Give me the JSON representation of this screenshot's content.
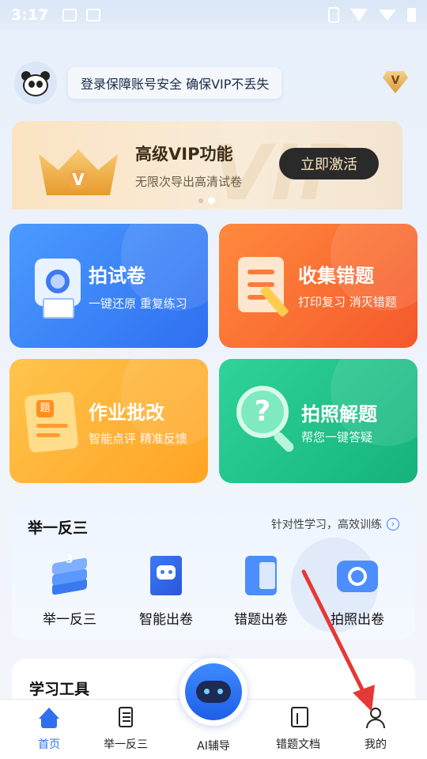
{
  "status": {
    "time": "3:17"
  },
  "header": {
    "banner": "登录保障账号安全 确保VIP不丢失",
    "vip_badge": "V"
  },
  "vip_card": {
    "title": "高级VIP功能",
    "subtitle": "无限次导出高清试卷",
    "button": "立即激活",
    "bg_text": "VIP",
    "crown_mark": "V",
    "pager": {
      "count": 2,
      "active": 2
    }
  },
  "tiles": [
    {
      "title": "拍试卷",
      "subtitle": "一键还原 重复练习",
      "icon": "camera-scan-icon"
    },
    {
      "title": "收集错题",
      "subtitle": "打印复习 消灭错题",
      "icon": "checklist-icon"
    },
    {
      "title": "作业批改",
      "subtitle": "智能点评 精准反馈",
      "icon": "homework-icon",
      "icon_text": "题"
    },
    {
      "title": "拍照解题",
      "subtitle": "帮您一键答疑",
      "icon": "question-search-icon",
      "icon_text": "?"
    }
  ],
  "practice": {
    "title": "举一反三",
    "link": "针对性学习，高效训练",
    "items": [
      {
        "label": "举一反三",
        "icon": "stack-icon",
        "icon_text": "3"
      },
      {
        "label": "智能出卷",
        "icon": "robot-book-icon"
      },
      {
        "label": "错题出卷",
        "icon": "wrong-paper-icon"
      },
      {
        "label": "拍照出卷",
        "icon": "camera-icon"
      }
    ]
  },
  "tools": {
    "title": "学习工具"
  },
  "tabbar": {
    "items": [
      {
        "label": "首页",
        "icon": "home-icon",
        "active": true
      },
      {
        "label": "举一反三",
        "icon": "book-list-icon"
      },
      {
        "label": "AI辅导",
        "icon": "ai-robot-icon"
      },
      {
        "label": "错题文档",
        "icon": "error-doc-icon"
      },
      {
        "label": "我的",
        "icon": "user-icon"
      }
    ]
  },
  "colors": {
    "primary": "#2f6ff0",
    "orange": "#f5582b",
    "yellow": "#ffa424",
    "green": "#16b27c",
    "annotation_arrow": "#e53935"
  }
}
